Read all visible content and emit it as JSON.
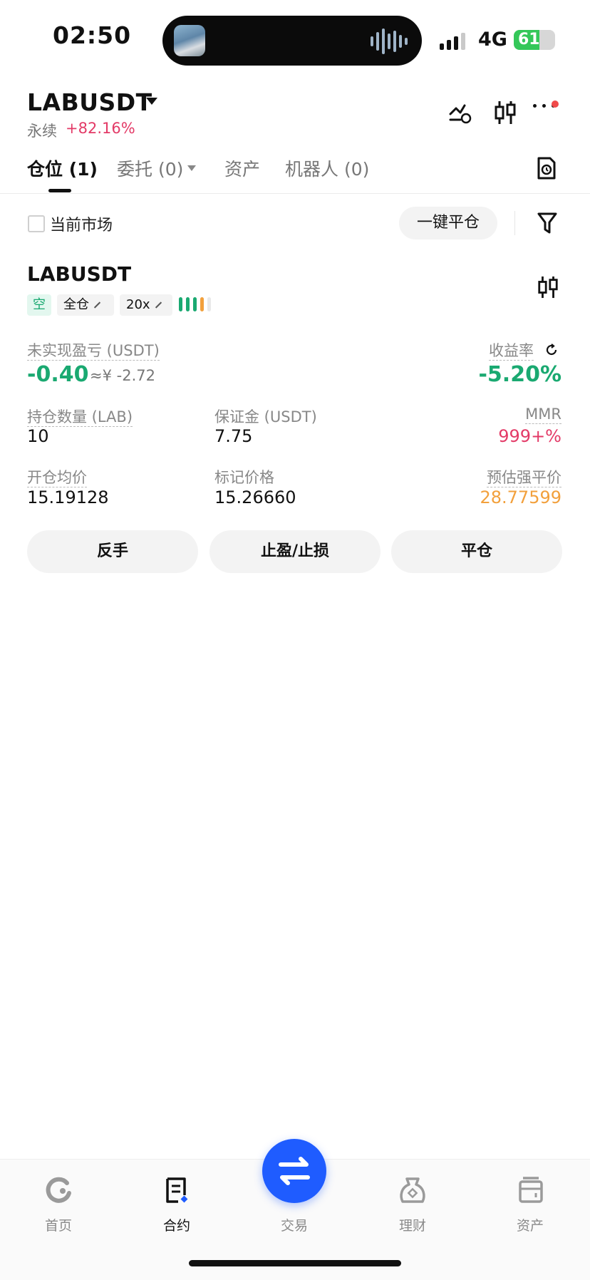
{
  "status_bar": {
    "time": "02:50",
    "network": "4G",
    "battery": "61"
  },
  "header": {
    "pair": "LABUSDT",
    "type": "永续",
    "change": "+82.16%"
  },
  "tabs": [
    {
      "label": "仓位 (1)",
      "active": true
    },
    {
      "label": "委托 (0)",
      "active": false
    },
    {
      "label": "资产",
      "active": false
    },
    {
      "label": "机器人 (0)",
      "active": false
    }
  ],
  "filter": {
    "current_market_label": "当前市场",
    "close_all_label": "一键平仓"
  },
  "position": {
    "symbol": "LABUSDT",
    "side_tag": "空",
    "margin_mode": "全仓",
    "leverage": "20x",
    "unrealized_pnl_label": "未实现盈亏 (USDT)",
    "unrealized_pnl": "-0.40",
    "unrealized_pnl_cny": "≈¥ -2.72",
    "roe_label": "收益率",
    "roe": "-5.20%",
    "qty_label": "持仓数量 (LAB)",
    "qty": "10",
    "margin_label": "保证金 (USDT)",
    "margin": "7.75",
    "mmr_label": "MMR",
    "mmr": "999+%",
    "entry_label": "开仓均价",
    "entry": "15.19128",
    "mark_label": "标记价格",
    "mark": "15.26660",
    "liq_label": "预估强平价",
    "liq": "28.77599"
  },
  "actions": {
    "reverse": "反手",
    "tpsl": "止盈/止损",
    "close": "平仓"
  },
  "nav": [
    {
      "label": "首页",
      "icon": "home-icon"
    },
    {
      "label": "合约",
      "icon": "contract-icon",
      "active": true
    },
    {
      "label": "交易",
      "icon": "swap-icon"
    },
    {
      "label": "理财",
      "icon": "finance-icon"
    },
    {
      "label": "资产",
      "icon": "wallet-icon"
    }
  ],
  "colors": {
    "green": "#1aa971",
    "red": "#e33a67",
    "orange": "#f2a03c",
    "accent": "#1f5cff"
  }
}
